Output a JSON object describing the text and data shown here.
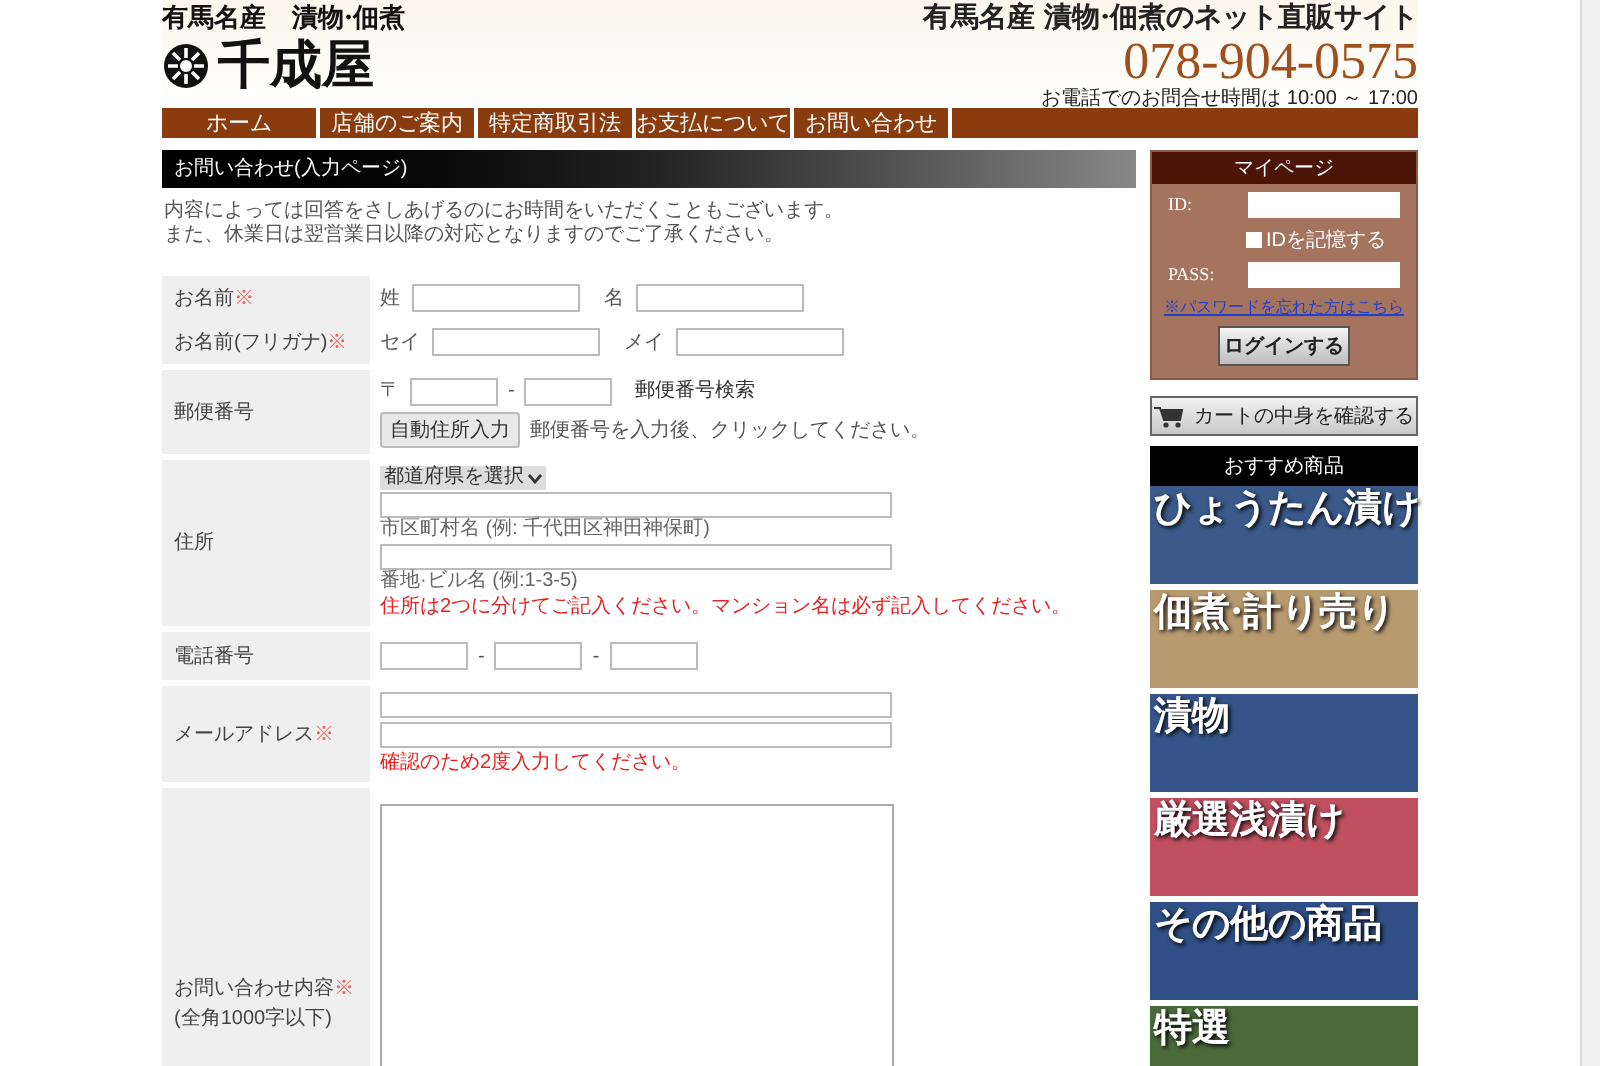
{
  "header": {
    "logo_top": "有馬名産　漬物·佃煮",
    "logo_name": "千成屋",
    "tagline": "有馬名産 漬物·佃煮のネット直販サイト",
    "phone": "078-904-0575",
    "hours": "お電話でのお問合せ時間は 10:00 ～ 17:00"
  },
  "nav": [
    "ホーム",
    "店舗のご案内",
    "特定商取引法",
    "お支払について",
    "お問い合わせ"
  ],
  "page_title": "お問い合わせ(入力ページ)",
  "intro": [
    "内容によっては回答をさしあげるのにお時間をいただくこともございます。",
    "また、休業日は翌営業日以降の対応となりますのでご了承ください。"
  ],
  "form": [
    {
      "kind": "pair",
      "label": "お名前",
      "mark": "※",
      "prefixes": [
        "姓",
        "名"
      ]
    },
    {
      "kind": "pair",
      "label": "お名前(フリガナ)",
      "mark": "※",
      "prefixes": [
        "セイ",
        "メイ"
      ]
    },
    {
      "kind": "zip",
      "label": "郵便番号",
      "prefix": "〒",
      "separator": "-",
      "search_link": "郵便番号検索",
      "button": "自動住所入力",
      "hint": "郵便番号を入力後、クリックしてください。"
    },
    {
      "kind": "address",
      "label": "住所",
      "select": "都道府県を選択",
      "captions": [
        "市区町村名 (例: 千代田区神田神保町)",
        "番地·ビル名 (例:1-3-5)"
      ],
      "note": "住所は2つに分けてご記入ください。マンション名は必ず記入してください。"
    },
    {
      "kind": "phone",
      "label": "電話番号",
      "separators": [
        "-",
        "-"
      ]
    },
    {
      "kind": "email",
      "label": "メールアドレス",
      "mark": "※",
      "note": "確認のため2度入力してください。"
    },
    {
      "kind": "textarea",
      "label": "お問い合わせ内容",
      "mark": "※",
      "sublabel": "(全角1000字以下)"
    }
  ],
  "mypage": {
    "title": "マイページ",
    "id_label": "ID:",
    "remember": {
      "label": "IDを記憶する",
      "checked": false
    },
    "pass_label": "PASS:",
    "forgot_link": "※パスワードを忘れた方はこちら",
    "login_button": "ログインする"
  },
  "cart_button": "カートの中身を確認する",
  "recommend": {
    "title": "おすすめ商品",
    "banners": [
      {
        "label": "ひょうたん漬け",
        "color": "#3b5a8a"
      },
      {
        "label": "佃煮·計り売り",
        "color": "#b89a70"
      },
      {
        "label": "漬物",
        "color": "#35558a"
      },
      {
        "label": "厳選浅漬け",
        "color": "#c05060"
      },
      {
        "label": "その他の商品",
        "color": "#2f4f86"
      },
      {
        "label": "特選",
        "color": "#4a6a3a"
      }
    ]
  }
}
